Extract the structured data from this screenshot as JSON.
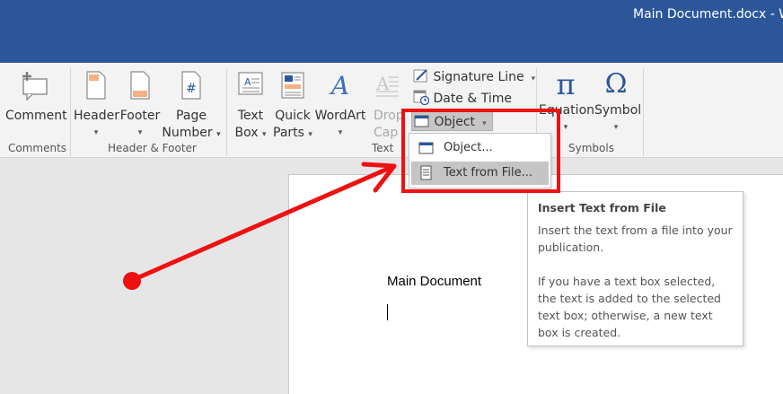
{
  "window": {
    "title": "Main Document.docx  -  Wo"
  },
  "ribbon": {
    "groups": {
      "comments": "Comments",
      "header_footer": "Header & Footer",
      "text": "Text",
      "symbols": "Symbols"
    },
    "buttons": {
      "comment": "Comment",
      "header": "Header",
      "footer": "Footer",
      "page_number_1": "Page",
      "page_number_2": "Number",
      "text_box_1": "Text",
      "text_box_2": "Box",
      "quick_parts_1": "Quick",
      "quick_parts_2": "Parts",
      "wordart": "WordArt",
      "drop_cap_1": "Drop",
      "drop_cap_2": "Cap",
      "signature_line": "Signature Line",
      "date_time": "Date & Time",
      "object": "Object",
      "equation": "Equation",
      "symbol": "Symbol"
    },
    "caret": "▾",
    "glyphs": {
      "pi": "π",
      "omega": "Ω",
      "hash": "#",
      "wordart_a": "A"
    }
  },
  "object_menu": {
    "items": [
      {
        "label": "Object..."
      },
      {
        "label": "Text from File..."
      }
    ]
  },
  "tooltip": {
    "title": "Insert Text from File",
    "p1": "Insert the text from a file into your publication.",
    "p2": "If you have a text box selected, the text is added to the selected text box; otherwise, a new text box is created."
  },
  "document": {
    "text": "Main Document"
  },
  "colors": {
    "titlebar": "#2b579a",
    "annotation_red": "#ee1111",
    "ribbon_bg": "#f3f3f3"
  }
}
